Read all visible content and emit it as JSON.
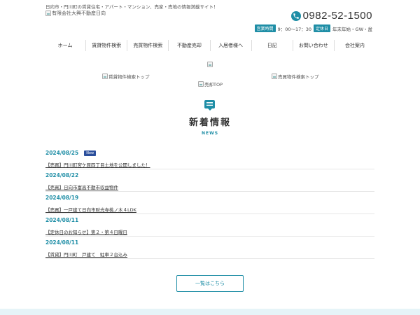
{
  "header": {
    "tagline": "日向市・門川町の賃貸住宅・アパート・マンション、売家・売地の情報満載サイト！",
    "logo_alt": "有限会社大興不動産日向",
    "phone": "0982-52-1500",
    "hours_badge": "営業時間",
    "hours_text": "9：00～17：30",
    "holiday_badge": "定休日",
    "holiday_text": "年末年始・GW・盆"
  },
  "nav": [
    {
      "label": "ホーム"
    },
    {
      "label": "賃貸物件検索"
    },
    {
      "label": "売買物件検索"
    },
    {
      "label": "不動産売却"
    },
    {
      "label": "入居者様へ"
    },
    {
      "label": "日記"
    },
    {
      "label": "お問い合わせ"
    },
    {
      "label": "会社案内"
    }
  ],
  "banners": {
    "rental": "賃貸物件検索トップ",
    "sale": "売買物件検索トップ",
    "selling": "売却TOP"
  },
  "news": {
    "title": "新着情報",
    "subtitle": "NEWS",
    "new_badge": "New",
    "items": [
      {
        "date": "2024/08/25",
        "text": "【売買】門川町宮ケ原四丁目土地を公開しました！"
      },
      {
        "date": "2024/08/22",
        "text": "【売買】日向市富高不動市収益物件"
      },
      {
        "date": "2024/08/19",
        "text": "【売買】一戸建て日向市財光寺桃ノ木４LDK"
      },
      {
        "date": "2024/08/11",
        "text": "【定休日のお知らせ】第２・第４日曜日"
      },
      {
        "date": "2024/08/11",
        "text": "【賃貸】門川町　戸建て　駐車２台込み"
      }
    ],
    "more_label": "一覧はこちら"
  },
  "colors": {
    "accent": "#1f8ea6",
    "new_badge": "#2b4f9c",
    "footer": "#e6f4f8"
  }
}
